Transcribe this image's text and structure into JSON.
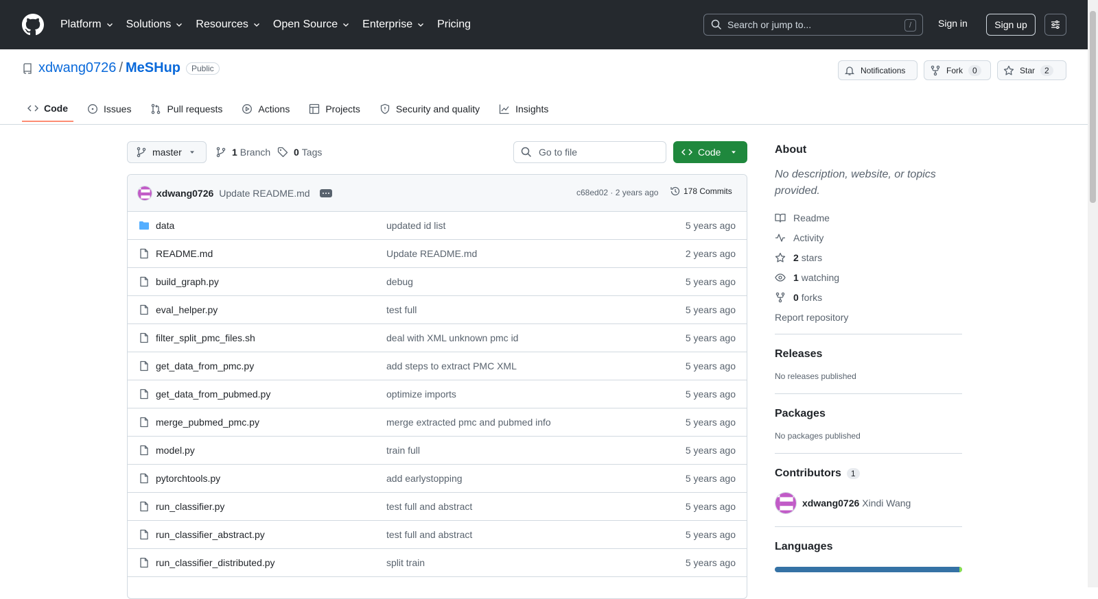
{
  "header": {
    "nav": [
      "Platform",
      "Solutions",
      "Resources",
      "Open Source",
      "Enterprise",
      "Pricing"
    ],
    "search_placeholder": "Search or jump to...",
    "search_shortcut": "/",
    "sign_in": "Sign in",
    "sign_up": "Sign up"
  },
  "repo": {
    "owner": "xdwang0726",
    "separator": "/",
    "name": "MeSHup",
    "visibility": "Public",
    "notifications_label": "Notifications",
    "fork_label": "Fork",
    "fork_count": "0",
    "star_label": "Star",
    "star_count": "2"
  },
  "tabs": [
    "Code",
    "Issues",
    "Pull requests",
    "Actions",
    "Projects",
    "Security and quality",
    "Insights"
  ],
  "toolbar": {
    "branch": "master",
    "branch_count": "1",
    "branch_label": "Branch",
    "tag_count": "0",
    "tag_label": "Tags",
    "go_to_file": "Go to file",
    "code_button": "Code"
  },
  "latest_commit": {
    "author": "xdwang0726",
    "message": "Update README.md",
    "hash_time": "c68ed02 · 2 years ago",
    "commits": "178 Commits"
  },
  "files": [
    {
      "name": "data",
      "type": "dir",
      "message": "updated id list",
      "age": "5 years ago"
    },
    {
      "name": "README.md",
      "type": "file",
      "message": "Update README.md",
      "age": "2 years ago"
    },
    {
      "name": "build_graph.py",
      "type": "file",
      "message": "debug",
      "age": "5 years ago"
    },
    {
      "name": "eval_helper.py",
      "type": "file",
      "message": "test full",
      "age": "5 years ago"
    },
    {
      "name": "filter_split_pmc_files.sh",
      "type": "file",
      "message": "deal with XML unknown pmc id",
      "age": "5 years ago"
    },
    {
      "name": "get_data_from_pmc.py",
      "type": "file",
      "message": "add steps to extract PMC XML",
      "age": "5 years ago"
    },
    {
      "name": "get_data_from_pubmed.py",
      "type": "file",
      "message": "optimize imports",
      "age": "5 years ago"
    },
    {
      "name": "merge_pubmed_pmc.py",
      "type": "file",
      "message": "merge extracted pmc and pubmed info",
      "age": "5 years ago"
    },
    {
      "name": "model.py",
      "type": "file",
      "message": "train full",
      "age": "5 years ago"
    },
    {
      "name": "pytorchtools.py",
      "type": "file",
      "message": "add earlystopping",
      "age": "5 years ago"
    },
    {
      "name": "run_classifier.py",
      "type": "file",
      "message": "test full and abstract",
      "age": "5 years ago"
    },
    {
      "name": "run_classifier_abstract.py",
      "type": "file",
      "message": "test full and abstract",
      "age": "5 years ago"
    },
    {
      "name": "run_classifier_distributed.py",
      "type": "file",
      "message": "split train",
      "age": "5 years ago"
    }
  ],
  "about": {
    "title": "About",
    "description": "No description, website, or topics provided.",
    "readme": "Readme",
    "activity": "Activity",
    "stars_count": "2",
    "stars_label": "stars",
    "watching_count": "1",
    "watching_label": "watching",
    "forks_count": "0",
    "forks_label": "forks",
    "report": "Report repository"
  },
  "releases": {
    "title": "Releases",
    "text": "No releases published"
  },
  "packages": {
    "title": "Packages",
    "text": "No packages published"
  },
  "contributors": {
    "title": "Contributors",
    "count": "1",
    "login": "xdwang0726",
    "name": "Xindi Wang"
  },
  "languages": {
    "title": "Languages"
  }
}
